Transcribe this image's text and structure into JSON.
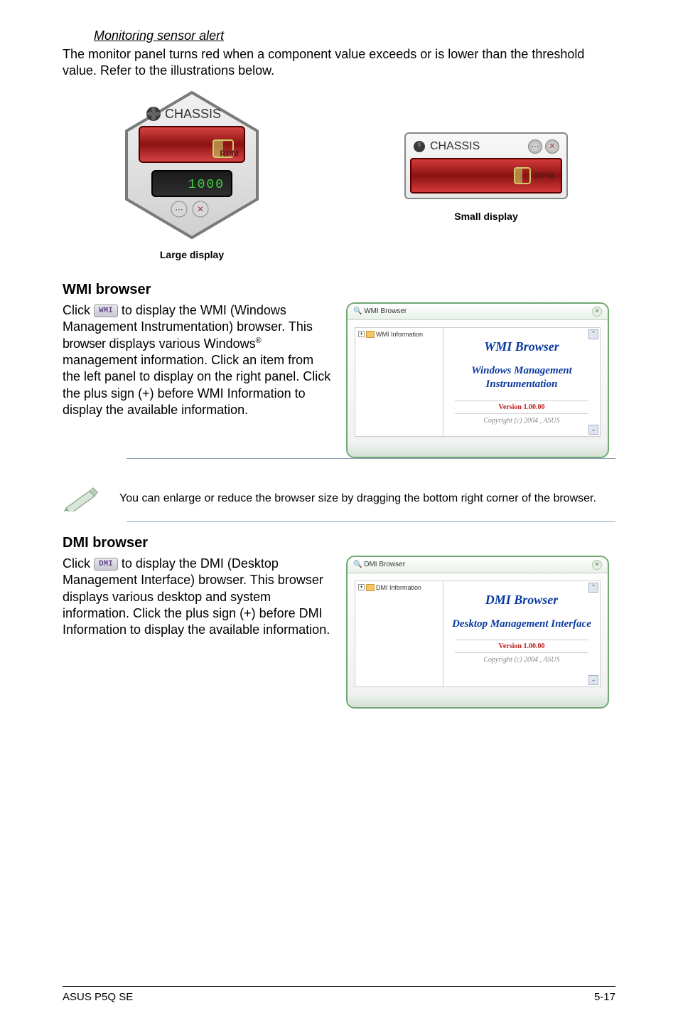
{
  "sensor_alert": {
    "heading": "Monitoring sensor alert",
    "body": "The monitor panel turns red when a component value exceeds or is lower than the threshold value. Refer to the illustrations below."
  },
  "large_panel": {
    "title": "CHASSIS",
    "rpm_label": "RPM",
    "lower_value": "1000",
    "caption": "Large display"
  },
  "small_panel": {
    "title": "CHASSIS",
    "rpm_label": "RPM",
    "caption": "Small display"
  },
  "wmi": {
    "title": "WMI browser",
    "btn": "WMI",
    "para_before": "Click ",
    "para_after_1": " to display the WMI (Windows Management Instrumentation) browser. This ",
    "para_after_2": "browser",
    "para_after_3": " displays various Windows",
    "para_after_4": " management information. Click an item from the left panel to display on the right panel. Click the plus sign (+) before WMI Information to display the available information.",
    "window": {
      "titlebar_icon_label": "WMI Browser",
      "tree_node": "WMI Information",
      "title": "WMI Browser",
      "subtitle": "Windows Management Instrumentation",
      "version": "Version 1.00.00",
      "copyright": "Copyright (c) 2004 , ASUS"
    }
  },
  "note": "You can enlarge or reduce the browser size by dragging the bottom right corner of the browser.",
  "dmi": {
    "title": "DMI browser",
    "btn": "DMI",
    "para_before": "Click ",
    "para_after": " to display the DMI (Desktop Management Interface) browser. This browser displays various desktop and system information. Click the plus sign (+) before DMI Information to display the available information.",
    "window": {
      "titlebar_icon_label": "DMI Browser",
      "tree_node": "DMI Information",
      "title": "DMI Browser",
      "subtitle": "Desktop Management Interface",
      "version": "Version 1.00.00",
      "copyright": "Copyright (c) 2004 , ASUS"
    }
  },
  "footer": {
    "left": "ASUS P5Q SE",
    "right": "5-17"
  }
}
